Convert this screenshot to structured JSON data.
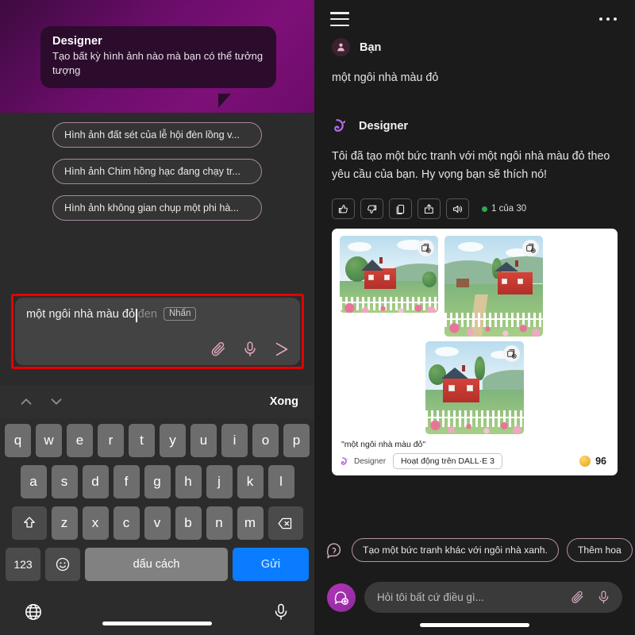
{
  "left": {
    "tooltip": {
      "title": "Designer",
      "body": "Tạo bất kỳ hình ảnh nào mà bạn có thể tưởng tượng"
    },
    "suggestions": [
      "Hình ảnh đất sét của lễ hội đèn lồng v...",
      "Hình ảnh Chim hồng hạc đang chạy tr...",
      "Hình ảnh không gian chụp một phi hà..."
    ],
    "composer": {
      "typed_text": "một ngôi nhà màu đỏ",
      "ghost_text": "đen",
      "suggestion_chip": "Nhấn",
      "attach_icon": "paperclip-icon",
      "mic_icon": "microphone-icon",
      "send_icon": "send-arrow-icon"
    },
    "keyboard": {
      "prev_icon": "chevron-up-icon",
      "next_icon": "chevron-down-icon",
      "done_label": "Xong",
      "row1": [
        "q",
        "w",
        "e",
        "r",
        "t",
        "y",
        "u",
        "i",
        "o",
        "p"
      ],
      "row2": [
        "a",
        "s",
        "d",
        "f",
        "g",
        "h",
        "j",
        "k",
        "l"
      ],
      "row3": [
        "z",
        "x",
        "c",
        "v",
        "b",
        "n",
        "m"
      ],
      "shift_icon": "shift-icon",
      "backspace_icon": "backspace-icon",
      "numbers_label": "123",
      "emoji_icon": "emoji-icon",
      "space_label": "dấu cách",
      "send_label": "Gửi",
      "globe_icon": "globe-icon",
      "dictation_icon": "microphone-icon"
    }
  },
  "right": {
    "header": {
      "menu_icon": "hamburger-menu-icon",
      "more_icon": "more-options-icon"
    },
    "messages": [
      {
        "sender": "Bạn",
        "avatar_icon": "user-avatar-icon",
        "text": "một ngôi nhà màu đỏ"
      },
      {
        "sender": "Designer",
        "avatar_icon": "designer-logo-icon",
        "text": "Tôi đã tạo một bức tranh với một ngôi nhà màu đỏ theo yêu cầu của bạn. Hy vọng bạn sẽ thích nó!"
      }
    ],
    "actions": [
      {
        "name": "thumbs-up-icon"
      },
      {
        "name": "thumbs-down-icon"
      },
      {
        "name": "copy-icon"
      },
      {
        "name": "share-icon"
      },
      {
        "name": "speaker-icon"
      }
    ],
    "counter_label": "1 của 30",
    "counter_dot_color": "#2fa84f",
    "image_card": {
      "add_icon": "add-to-collection-icon",
      "images": [
        {
          "alt": "Ngôi nhà màu đỏ với hàng rào trắng và đồi xanh"
        },
        {
          "alt": "Ngôi nhà màu đỏ bên đường mòn với hoa hồng"
        },
        {
          "alt": "Ngôi nhà màu đỏ với vườn hoa phía trước"
        }
      ],
      "caption": "\"một ngôi nhà màu đỏ\"",
      "brand_label": "Designer",
      "brand_icon": "designer-logo-icon",
      "powered_label": "Hoạt động trên DALL·E 3",
      "coin_icon": "coin-icon",
      "credits": "96"
    },
    "suggestions": {
      "help_icon": "question-bubble-icon",
      "chips": [
        "Tạo một bức tranh khác với ngôi nhà xanh.",
        "Thêm hoa"
      ]
    },
    "composer": {
      "avatar_icon": "new-chat-icon",
      "placeholder": "Hỏi tôi bất cứ điều gì...",
      "attach_icon": "paperclip-icon",
      "mic_icon": "microphone-icon"
    }
  },
  "colors": {
    "accent_purple": "#7d1078",
    "send_blue": "#0a7cff",
    "annotation_red": "#e60000",
    "status_green": "#2fa84f"
  }
}
